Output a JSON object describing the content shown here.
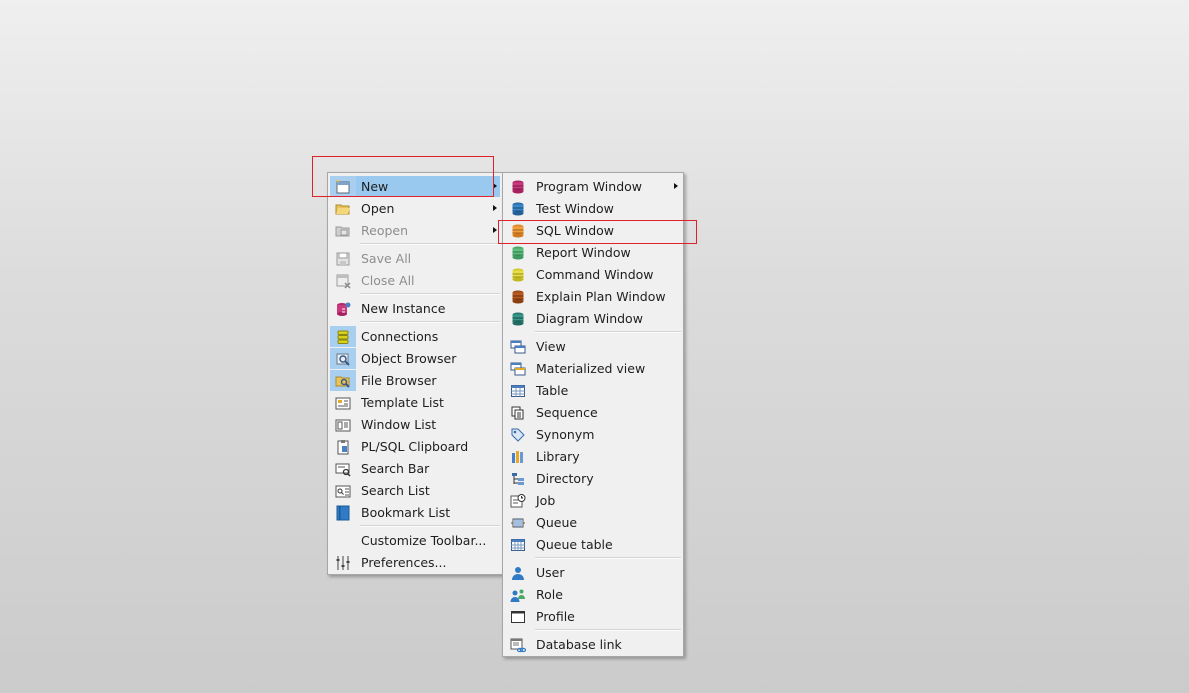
{
  "main_menu": {
    "items": [
      {
        "label": "New",
        "icon": "new-window-icon",
        "submenu": true,
        "selected": true
      },
      {
        "label": "Open",
        "icon": "open-folder-icon",
        "submenu": true
      },
      {
        "label": "Reopen",
        "icon": "reopen-icon",
        "submenu": true,
        "disabled": true
      },
      {
        "label": "Save All",
        "icon": "save-all-icon",
        "disabled": true
      },
      {
        "label": "Close All",
        "icon": "close-all-icon",
        "disabled": true
      },
      {
        "label": "New Instance",
        "icon": "new-instance-icon"
      },
      {
        "label": "Connections",
        "icon": "connections-icon",
        "highlighted_icon": true
      },
      {
        "label": "Object Browser",
        "icon": "object-browser-icon",
        "highlighted_icon": true
      },
      {
        "label": "File Browser",
        "icon": "file-browser-icon",
        "highlighted_icon": true
      },
      {
        "label": "Template List",
        "icon": "template-list-icon"
      },
      {
        "label": "Window List",
        "icon": "window-list-icon"
      },
      {
        "label": "PL/SQL Clipboard",
        "icon": "clipboard-icon"
      },
      {
        "label": "Search Bar",
        "icon": "search-bar-icon"
      },
      {
        "label": "Search List",
        "icon": "search-list-icon"
      },
      {
        "label": "Bookmark List",
        "icon": "bookmark-list-icon"
      },
      {
        "label": "Customize Toolbar...",
        "icon": ""
      },
      {
        "label": "Preferences...",
        "icon": "preferences-icon"
      }
    ]
  },
  "sub_menu": {
    "items": [
      {
        "label": "Program Window",
        "icon": "program-window-icon",
        "submenu": true
      },
      {
        "label": "Test Window",
        "icon": "test-window-icon"
      },
      {
        "label": "SQL Window",
        "icon": "sql-window-icon"
      },
      {
        "label": "Report Window",
        "icon": "report-window-icon"
      },
      {
        "label": "Command Window",
        "icon": "command-window-icon"
      },
      {
        "label": "Explain Plan Window",
        "icon": "explain-plan-window-icon"
      },
      {
        "label": "Diagram Window",
        "icon": "diagram-window-icon"
      },
      {
        "label": "View",
        "icon": "view-icon"
      },
      {
        "label": "Materialized view",
        "icon": "materialized-view-icon"
      },
      {
        "label": "Table",
        "icon": "table-icon"
      },
      {
        "label": "Sequence",
        "icon": "sequence-icon"
      },
      {
        "label": "Synonym",
        "icon": "synonym-icon"
      },
      {
        "label": "Library",
        "icon": "library-icon"
      },
      {
        "label": "Directory",
        "icon": "directory-icon"
      },
      {
        "label": "Job",
        "icon": "job-icon"
      },
      {
        "label": "Queue",
        "icon": "queue-icon"
      },
      {
        "label": "Queue table",
        "icon": "queue-table-icon"
      },
      {
        "label": "User",
        "icon": "user-icon"
      },
      {
        "label": "Role",
        "icon": "role-icon"
      },
      {
        "label": "Profile",
        "icon": "profile-icon"
      },
      {
        "label": "Database link",
        "icon": "database-link-icon"
      }
    ]
  },
  "colors": {
    "selection": "#99c9ef",
    "annotation_box": "#e0202a"
  }
}
